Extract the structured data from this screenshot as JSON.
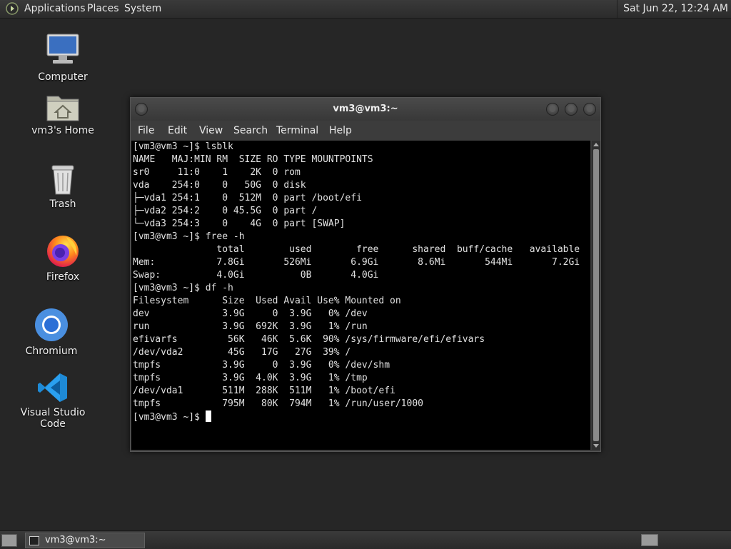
{
  "top_panel": {
    "menus": [
      "Applications",
      "Places",
      "System"
    ],
    "clock": "Sat Jun 22, 12:24 AM"
  },
  "desktop_icons": [
    {
      "label": "Computer",
      "icon": "computer-icon"
    },
    {
      "label": "vm3's Home",
      "icon": "home-folder-icon"
    },
    {
      "label": "Trash",
      "icon": "trash-icon"
    },
    {
      "label": "Firefox",
      "icon": "firefox-icon"
    },
    {
      "label": "Chromium",
      "icon": "chromium-icon"
    },
    {
      "label": "Visual Studio Code",
      "icon": "vscode-icon"
    }
  ],
  "window": {
    "title": "vm3@vm3:~",
    "menu": [
      "File",
      "Edit",
      "View",
      "Search",
      "Terminal",
      "Help"
    ]
  },
  "terminal": {
    "lines": [
      "[vm3@vm3 ~]$ lsblk",
      "NAME   MAJ:MIN RM  SIZE RO TYPE MOUNTPOINTS",
      "sr0     11:0    1    2K  0 rom",
      "vda    254:0    0   50G  0 disk",
      "├─vda1 254:1    0  512M  0 part /boot/efi",
      "├─vda2 254:2    0 45.5G  0 part /",
      "└─vda3 254:3    0    4G  0 part [SWAP]",
      "[vm3@vm3 ~]$ free -h",
      "               total        used        free      shared  buff/cache   available",
      "Mem:           7.8Gi       526Mi       6.9Gi       8.6Mi       544Mi       7.2Gi",
      "Swap:          4.0Gi          0B       4.0Gi",
      "[vm3@vm3 ~]$ df -h",
      "Filesystem      Size  Used Avail Use% Mounted on",
      "dev             3.9G     0  3.9G   0% /dev",
      "run             3.9G  692K  3.9G   1% /run",
      "efivarfs         56K   46K  5.6K  90% /sys/firmware/efi/efivars",
      "/dev/vda2        45G   17G   27G  39% /",
      "tmpfs           3.9G     0  3.9G   0% /dev/shm",
      "tmpfs           3.9G  4.0K  3.9G   1% /tmp",
      "/dev/vda1       511M  288K  511M   1% /boot/efi",
      "tmpfs           795M   80K  794M   1% /run/user/1000"
    ],
    "prompt": "[vm3@vm3 ~]$ "
  },
  "taskbar": {
    "task_label": "vm3@vm3:~"
  }
}
